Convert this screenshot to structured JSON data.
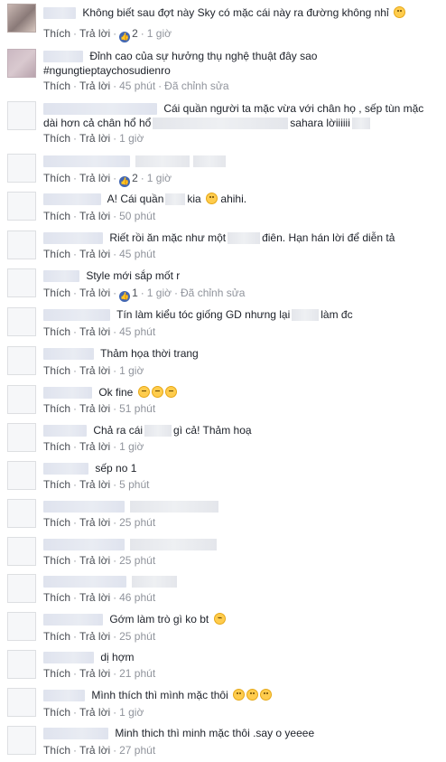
{
  "labels": {
    "like": "Thích",
    "reply": "Trả lời",
    "edited": "Đã chỉnh sửa",
    "dot": "·"
  },
  "comments": [
    {
      "text": "Không biết sau đợt này Sky có mặc cái này ra đường không nhỉ",
      "likes": "2",
      "time": "1 giờ",
      "emoji": [
        "laugh"
      ]
    },
    {
      "text": "Đỉnh cao của sự hưởng thụ nghệ thuật đây sao",
      "text2": "#ngungtieptaychosudienro",
      "time": "45 phút",
      "edited": true
    },
    {
      "text": "Cái quần người ta mặc vừa với chân họ , sếp tùn mặc",
      "text2a": "dài hơn cả chân hổ hổ",
      "text2b": "sahara lời",
      "text2c": "iiiii",
      "time": "1 giờ"
    },
    {
      "text": "",
      "likes": "2",
      "time": "1 giờ"
    },
    {
      "text": "A! Cái quần",
      "text_b": "kia",
      "text_c": "ahihi.",
      "time": "50 phút",
      "emoji": [
        "smile"
      ]
    },
    {
      "text": "Riết rồi ăn mặc như một",
      "text_b": "điên. Hạn hán lời để diễn tả",
      "time": "45 phút"
    },
    {
      "text": "Style mới sắp mốt r",
      "likes": "1",
      "time": "1 giờ",
      "edited": true
    },
    {
      "text": "Tín làm kiểu tóc giống GD nhưng lại",
      "text_b": "làm đc",
      "time": "45 phút"
    },
    {
      "text": "Thảm họa thời trang",
      "time": "1 giờ"
    },
    {
      "text": "Ok fine",
      "time": "51 phút",
      "emoji": [
        "smirk",
        "smirk",
        "smirk"
      ]
    },
    {
      "text": "Chả ra cái",
      "text_b": "gì cả! Thảm hoạ",
      "time": "1 giờ"
    },
    {
      "text": "sếp no 1",
      "time": "5 phút"
    },
    {
      "text": "",
      "time": "25 phút"
    },
    {
      "text": "",
      "time": "25 phút"
    },
    {
      "text": "",
      "time": "46 phút"
    },
    {
      "text": "Gớm làm trò gì ko bt",
      "time": "25 phút",
      "emoji": [
        "tired"
      ]
    },
    {
      "text": "dị hợm",
      "time": "21 phút"
    },
    {
      "text": "Mình thích thì mình mặc thôi",
      "time": "1 giờ",
      "emoji": [
        "grin",
        "grin",
        "grin"
      ]
    },
    {
      "text": "Minh thich thì minh mặc thôi .say o yeeee",
      "time": "27 phút"
    }
  ]
}
